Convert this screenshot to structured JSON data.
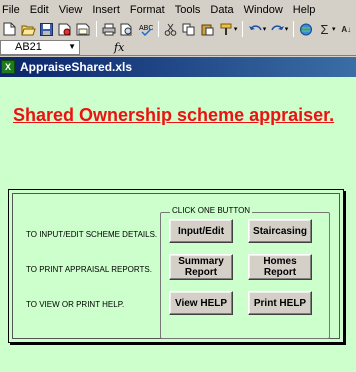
{
  "menu": [
    "File",
    "Edit",
    "View",
    "Insert",
    "Format",
    "Tools",
    "Data",
    "Window",
    "Help"
  ],
  "toolbar": {
    "icons": [
      "new-document-icon",
      "open-folder-icon",
      "save-icon",
      "permission-icon",
      "email-icon",
      "print-icon",
      "print-preview-icon",
      "spelling-icon",
      "cut-icon",
      "copy-icon",
      "paste-icon",
      "format-painter-icon",
      "undo-icon",
      "redo-icon",
      "hyperlink-icon",
      "autosum-icon",
      "sort-icon"
    ]
  },
  "formula_bar": {
    "cell_ref": "AB21",
    "fx_label": "fx"
  },
  "window": {
    "title": "AppraiseShared.xls"
  },
  "sheet": {
    "title": "Shared Ownership scheme appraiser.",
    "group_label": "CLICK ONE BUTTON",
    "rows": [
      {
        "label": "TO INPUT/EDIT SCHEME DETAILS."
      },
      {
        "label": "TO PRINT APPRAISAL REPORTS."
      },
      {
        "label": "TO VIEW OR PRINT HELP."
      }
    ],
    "buttons": {
      "input_edit": "Input/Edit",
      "staircasing": "Staircasing",
      "summary_report": "Summary Report",
      "homes_report": "Homes Report",
      "view_help": "View HELP",
      "print_help": "Print HELP"
    }
  },
  "colors": {
    "sheet_bg": "#ccffcc",
    "title_red": "#ee1111",
    "titlebar": "#0a246a"
  }
}
